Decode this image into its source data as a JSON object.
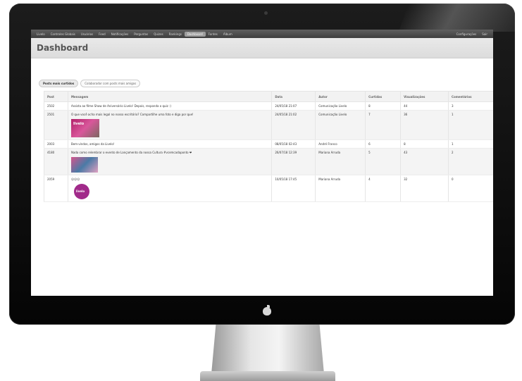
{
  "nav": {
    "items": [
      "Livelo",
      "Controles Globais",
      "Usuários",
      "Feed",
      "Notificações",
      "Perguntas",
      "Quizes",
      "Rankings",
      "Dashboard",
      "Fontes",
      "Álbum"
    ],
    "active_index": 8,
    "right": [
      "Configurações",
      "Sair"
    ]
  },
  "header": {
    "title": "Dashboard"
  },
  "tabs": [
    {
      "label": "Posts mais curtidos",
      "active": true
    },
    {
      "label": "Colaborador com posts mais amigos",
      "active": false
    }
  ],
  "table": {
    "columns": [
      "Post",
      "Mensagem",
      "Data",
      "Autor",
      "Curtidas",
      "Visualizações",
      "Comentários"
    ],
    "rows": [
      {
        "post": "2502",
        "mensagem": "Assista ao filme Show de Aniversário Livelo! Depois, responda o quiz :)",
        "data": "24/05/18 21:07",
        "autor": "Comunicação Livelo",
        "curtidas": "8",
        "visualizacoes": "44",
        "comentarios": "3",
        "thumb": ""
      },
      {
        "post": "2501",
        "mensagem": "O que você acha mais legal no nosso escritório? Compartilhe uma foto e diga por que!",
        "data": "24/05/18 21:02",
        "autor": "Comunicação Livelo",
        "curtidas": "7",
        "visualizacoes": "36",
        "comentarios": "1",
        "thumb": "livelo",
        "thumb_text": "livelo"
      },
      {
        "post": "2003",
        "mensagem": "Bem-vindos, amigos da Livelo!",
        "data": "08/05/18 02:43",
        "autor": "André Franco",
        "curtidas": "6",
        "visualizacoes": "8",
        "comentarios": "1",
        "thumb": ""
      },
      {
        "post": "4180",
        "mensagem": "Nada como relembrar o evento de Lançamento da nossa Cultura #vcemcadaponto ❤",
        "data": "26/07/18 12:39",
        "autor": "Mariana Arruda",
        "curtidas": "5",
        "visualizacoes": "43",
        "comentarios": "2",
        "thumb": "event"
      },
      {
        "post": "2059",
        "mensagem": "☺☺☺",
        "data": "10/05/18 17:45",
        "autor": "Mariana Arruda",
        "curtidas": "4",
        "visualizacoes": "32",
        "comentarios": "0",
        "thumb": "logo",
        "thumb_text": "livelo"
      }
    ]
  }
}
